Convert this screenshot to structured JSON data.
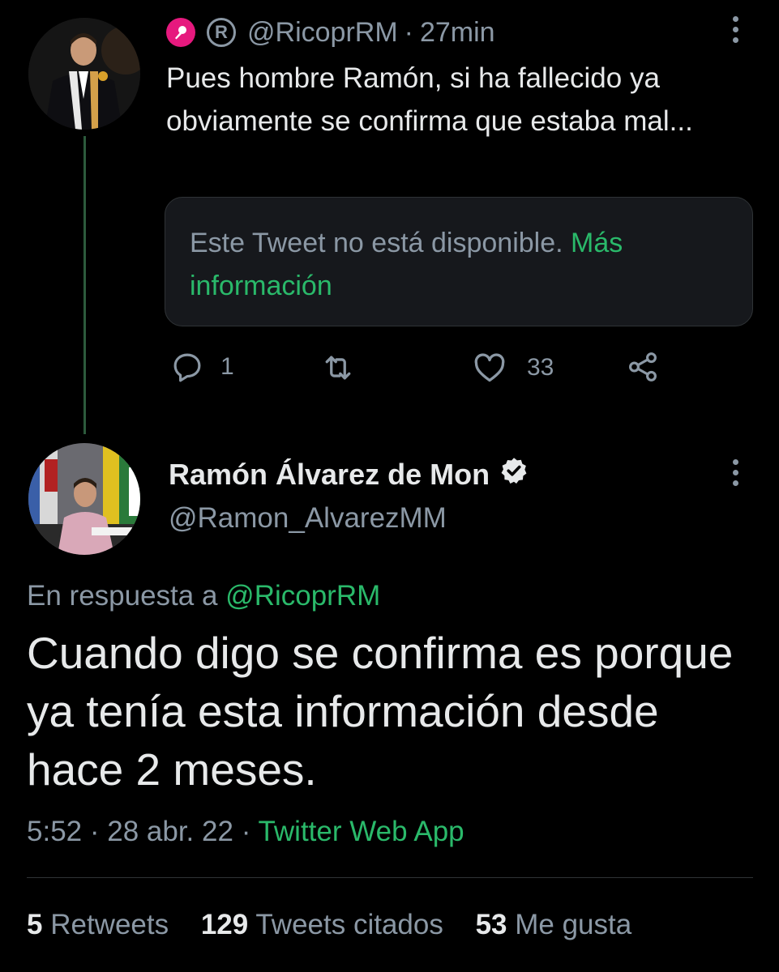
{
  "reply_tweet": {
    "handle": "@RicoprRM",
    "separator": "·",
    "time": "27min",
    "text": "Pues hombre Ramón, si ha fallecido ya obviamente se confirma que estaba mal...",
    "unavailable_notice": "Este Tweet no está disponible.",
    "unavailable_link": "Más información",
    "reply_count": "1",
    "like_count": "33",
    "icons": [
      "reply-icon",
      "retweet-icon",
      "like-icon",
      "share-icon"
    ]
  },
  "main_tweet": {
    "display_name": "Ramón Álvarez de Mon",
    "handle": "@Ramon_AlvarezMM",
    "in_reply_prefix": "En respuesta a",
    "in_reply_handle": "@RicoprRM",
    "text": "Cuando digo se confirma es porque ya tenía esta información desde hace 2 meses.",
    "time": "5:52",
    "date": "28 abr. 22",
    "sep": "·",
    "source": "Twitter Web App",
    "retweets_count": "5",
    "retweets_label": "Retweets",
    "quotes_count": "129",
    "quotes_label": "Tweets citados",
    "likes_count": "53",
    "likes_label": "Me gusta"
  },
  "colors": {
    "background": "#000000",
    "accent_green": "#2ab96a",
    "muted": "#8b98a5",
    "text": "#e7e9ea",
    "pink_badge": "#e6197e"
  }
}
